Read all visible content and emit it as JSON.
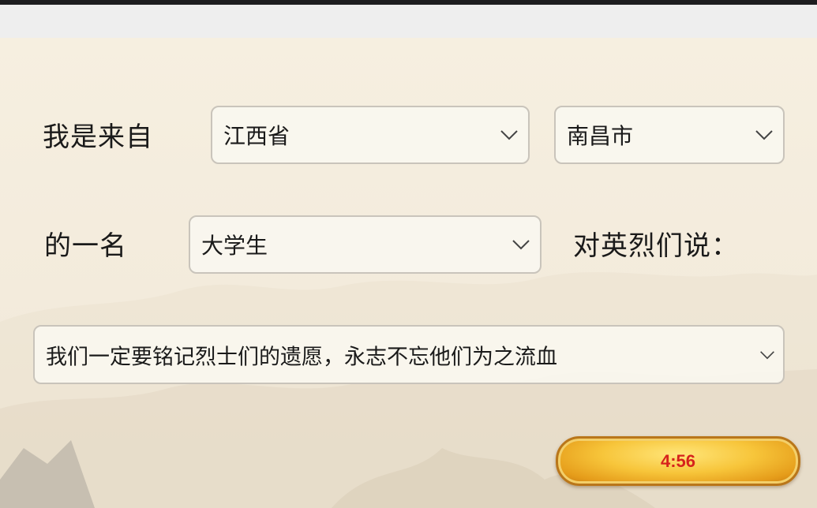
{
  "form": {
    "intro_label": "我是来自",
    "province_value": "江西省",
    "city_value": "南昌市",
    "role_prefix_label": "的一名",
    "role_value": "大学生",
    "say_to_martyrs_label": "对英烈们说：",
    "message_value": "我们一定要铭记烈士们的遗愿，永志不忘他们为之流血"
  },
  "timer": {
    "value": "4:56"
  },
  "icons": {
    "dropdown": "chevron-down-icon"
  },
  "colors": {
    "timer_text": "#d6231c",
    "timer_button": "#f7c53a",
    "background": "#f6efe0"
  }
}
